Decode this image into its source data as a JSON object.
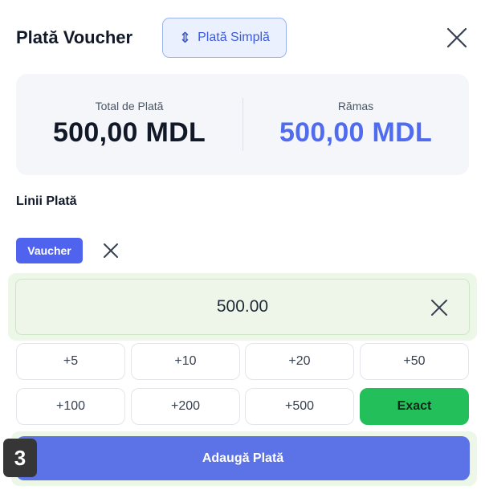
{
  "header": {
    "title": "Plată Voucher",
    "mode_button": {
      "label": "Plată Simplă",
      "icon": "sliders-icon"
    },
    "close_icon": "close-icon"
  },
  "summary": {
    "total_label": "Total de Plată",
    "total_value": "500,00 MDL",
    "remaining_label": "Rămas",
    "remaining_value": "500,00 MDL"
  },
  "payment_lines": {
    "label": "Linii Plată",
    "method_chip": "Vaucher",
    "amount": "500.00"
  },
  "quick_amounts": [
    "+5",
    "+10",
    "+20",
    "+50",
    "+100",
    "+200",
    "+500"
  ],
  "exact_label": "Exact",
  "submit_label": "Adaugă Plată",
  "step_badge": "3",
  "colors": {
    "accent": "#4f6bef",
    "chip": "#4f63ee",
    "exact": "#22bf5a",
    "submit": "#5b73e6",
    "highlight": "#edf7e8"
  }
}
